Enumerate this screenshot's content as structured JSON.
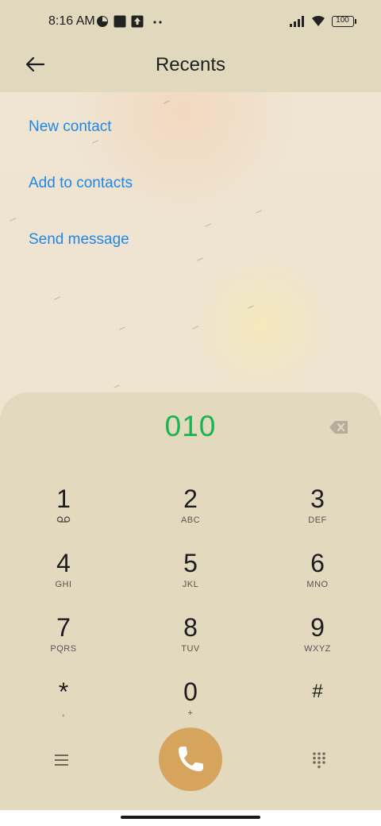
{
  "status": {
    "time": "8:16 AM",
    "battery": "100",
    "icons": [
      "data-usage-icon",
      "square-app-icon",
      "upload-arrow-icon",
      "more-dots-icon",
      "signal-icon",
      "wifi-icon",
      "battery-icon"
    ]
  },
  "header": {
    "title": "Recents",
    "back_icon": "back-arrow-icon"
  },
  "actions": {
    "new_contact": "New contact",
    "add_to_contacts": "Add to contacts",
    "send_message": "Send message"
  },
  "dialpad": {
    "number": "010",
    "keys": [
      {
        "digit": "1",
        "letters": ""
      },
      {
        "digit": "2",
        "letters": "ABC"
      },
      {
        "digit": "3",
        "letters": "DEF"
      },
      {
        "digit": "4",
        "letters": "GHI"
      },
      {
        "digit": "5",
        "letters": "JKL"
      },
      {
        "digit": "6",
        "letters": "MNO"
      },
      {
        "digit": "7",
        "letters": "PQRS"
      },
      {
        "digit": "8",
        "letters": "TUV"
      },
      {
        "digit": "9",
        "letters": "WXYZ"
      },
      {
        "digit": "*",
        "letters": ","
      },
      {
        "digit": "0",
        "letters": "+"
      },
      {
        "digit": "#",
        "letters": ""
      }
    ]
  },
  "colors": {
    "accent_blue": "#1f87e5",
    "number_green": "#19b451",
    "call_button": "#d6a45c",
    "panel": "#e2d9be"
  }
}
